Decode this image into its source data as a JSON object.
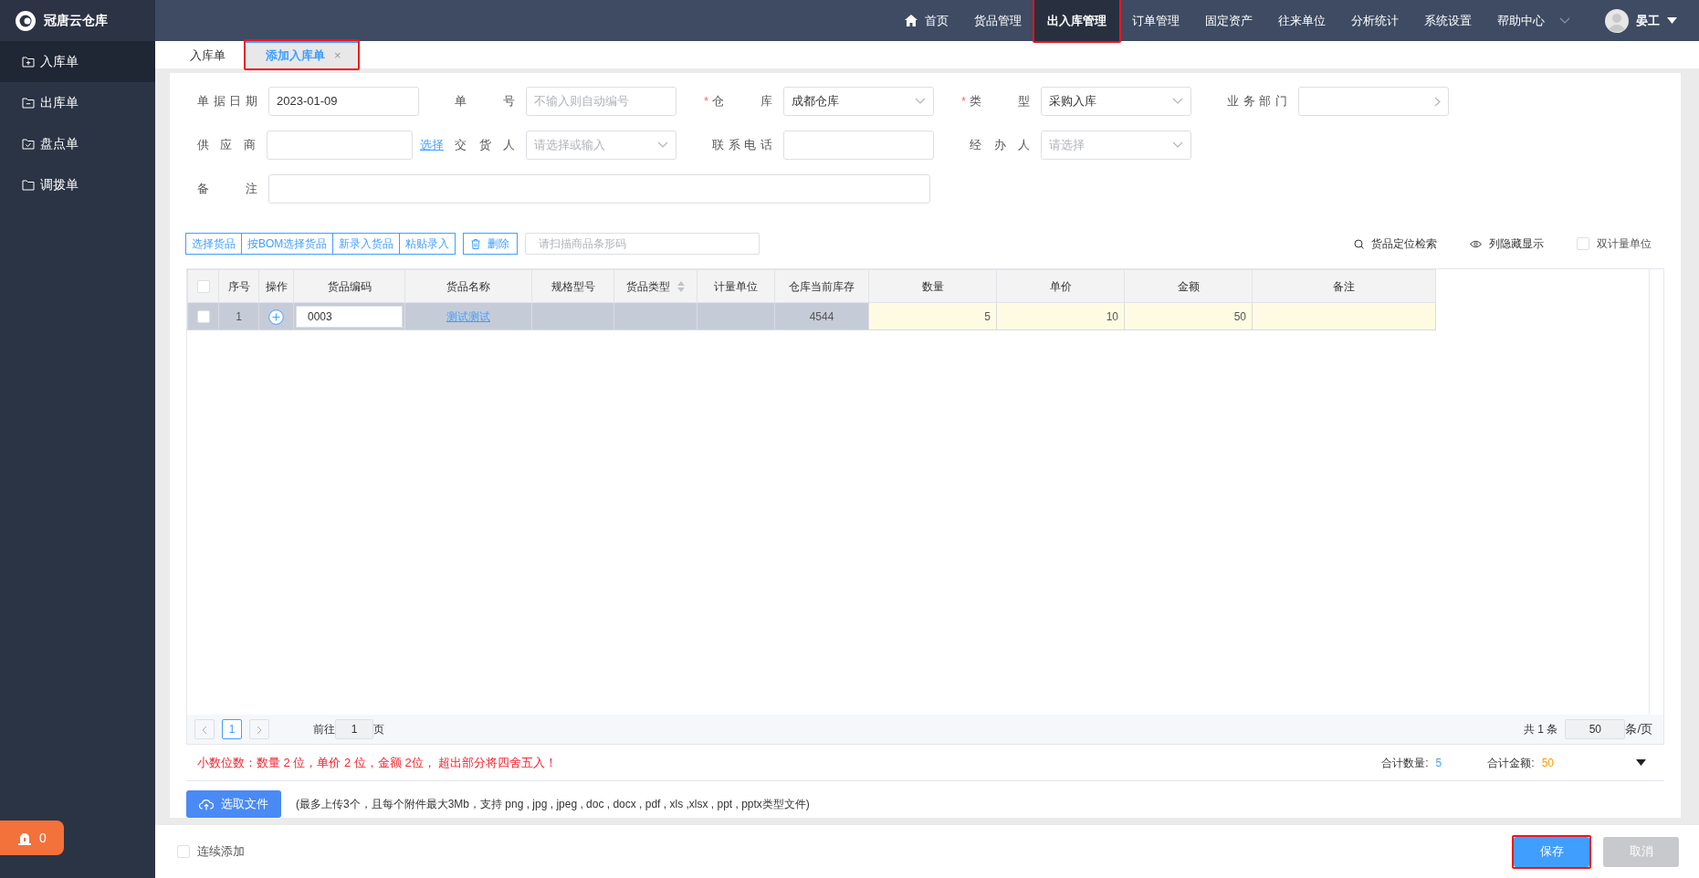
{
  "app": {
    "name": "冠唐云仓库"
  },
  "top_nav": [
    {
      "label": "首页",
      "kind": "home",
      "selected": false,
      "highlighted": false
    },
    {
      "label": "货品管理",
      "selected": false,
      "highlighted": false
    },
    {
      "label": "出入库管理",
      "selected": true,
      "highlighted": true
    },
    {
      "label": "订单管理",
      "selected": false,
      "highlighted": false
    },
    {
      "label": "固定资产",
      "selected": false,
      "highlighted": false
    },
    {
      "label": "往来单位",
      "selected": false,
      "highlighted": false
    },
    {
      "label": "分析统计",
      "selected": false,
      "highlighted": false
    },
    {
      "label": "系统设置",
      "selected": false,
      "highlighted": false
    },
    {
      "label": "帮助中心",
      "kind": "dropdown",
      "selected": false,
      "highlighted": false
    }
  ],
  "user": {
    "name": "晏工"
  },
  "sidebar": {
    "items": [
      {
        "label": "入库单",
        "selected": true
      },
      {
        "label": "出库单",
        "selected": false
      },
      {
        "label": "盘点单",
        "selected": false
      },
      {
        "label": "调拨单",
        "selected": false
      }
    ],
    "alarm": {
      "count": "0"
    }
  },
  "tabs": [
    {
      "label": "入库单",
      "selected": false,
      "highlighted": false
    },
    {
      "label": "添加入库单",
      "selected": true,
      "close": "×",
      "highlighted": true
    }
  ],
  "form": {
    "rows": [
      [
        {
          "label": "单据日期",
          "kind": "text",
          "value": "2023-01-09"
        },
        {
          "label": "单号",
          "kind": "text",
          "placeholder": "不输入则自动编号"
        },
        {
          "label": "仓库",
          "mark": "*",
          "kind": "select",
          "value": "成都仓库"
        },
        {
          "label": "类型",
          "mark": "*",
          "kind": "select",
          "value": "采购入库"
        },
        {
          "label": "业务部门",
          "kind": "cascader"
        }
      ],
      [
        {
          "label": "供应商",
          "kind": "text",
          "link": "选择"
        },
        {
          "label": "交货人",
          "kind": "select",
          "placeholder": "请选择或输入"
        },
        {
          "label": "联系电话",
          "kind": "text"
        },
        {
          "label": "经办人",
          "kind": "select",
          "placeholder": "请选择"
        }
      ],
      [
        {
          "label": "备注",
          "kind": "wide"
        }
      ]
    ]
  },
  "toolbar": {
    "group": [
      "选择货品",
      "按BOM选择货品",
      "新录入货品",
      "粘贴录入"
    ],
    "delete": "删除",
    "barcode": {
      "placeholder": "请扫描商品条形码"
    },
    "right": [
      {
        "kind": "search",
        "label": "货品定位检索"
      },
      {
        "kind": "eye",
        "label": "列隐藏显示"
      },
      {
        "kind": "checkbox",
        "label": "双计量单位",
        "checked": false
      }
    ]
  },
  "table": {
    "columns": [
      {
        "kind": "checkbox",
        "checked": false
      },
      {
        "kind": "text",
        "label": "序号"
      },
      {
        "kind": "text",
        "label": "操作"
      },
      {
        "kind": "text",
        "label": "货品编码"
      },
      {
        "kind": "text",
        "label": "货品名称"
      },
      {
        "kind": "text",
        "label": "规格型号"
      },
      {
        "kind": "sortable",
        "label": "货品类型"
      },
      {
        "kind": "text",
        "label": "计量单位"
      },
      {
        "kind": "text",
        "label": "仓库当前库存"
      },
      {
        "kind": "text",
        "label": "数量"
      },
      {
        "kind": "text",
        "label": "单价"
      },
      {
        "kind": "text",
        "label": "金额"
      },
      {
        "kind": "text",
        "label": "备注"
      }
    ],
    "rows": [
      {
        "checked": false,
        "current": true,
        "cells": [
          {
            "kind": "checkbox"
          },
          {
            "kind": "text",
            "text": "1"
          },
          {
            "kind": "add"
          },
          {
            "kind": "input",
            "text": "0003"
          },
          {
            "kind": "link",
            "text": "测试测试"
          },
          {
            "kind": "empty"
          },
          {
            "kind": "empty"
          },
          {
            "kind": "empty"
          },
          {
            "kind": "text",
            "text": "4544"
          },
          {
            "kind": "number",
            "text": "5",
            "editable": true
          },
          {
            "kind": "number",
            "text": "10",
            "editable": true
          },
          {
            "kind": "number",
            "text": "50",
            "editable": true
          },
          {
            "kind": "empty",
            "editable": true
          }
        ]
      }
    ]
  },
  "pagination": {
    "pages": [
      {
        "label": "1",
        "selected": true
      }
    ],
    "goto_label": "前往",
    "goto_value": "1",
    "goto_suffix": "页",
    "total": "共 1 条",
    "page_size": "50",
    "page_size_suffix": "条/页"
  },
  "notice": "小数位数：数量 2 位，单价 2 位，金额 2位， 超出部分将四舍五入！",
  "totals": [
    {
      "label": "合计数量:",
      "value": "5",
      "color": "#409eff"
    },
    {
      "label": "合计金额:",
      "value": "50",
      "color": "#ff9900"
    }
  ],
  "upload": {
    "button": "选取文件",
    "hint": "(最多上传3个，且每个附件最大3Mb，支持 png , jpg , jpeg , doc , docx , pdf , xls ,xlsx , ppt , pptx类型文件)"
  },
  "footer": {
    "continue": {
      "label": "连续添加",
      "checked": false
    },
    "buttons": [
      {
        "label": "保存",
        "kind": "primary",
        "highlighted": true
      },
      {
        "label": "取消",
        "kind": "muted",
        "highlighted": false
      }
    ]
  }
}
